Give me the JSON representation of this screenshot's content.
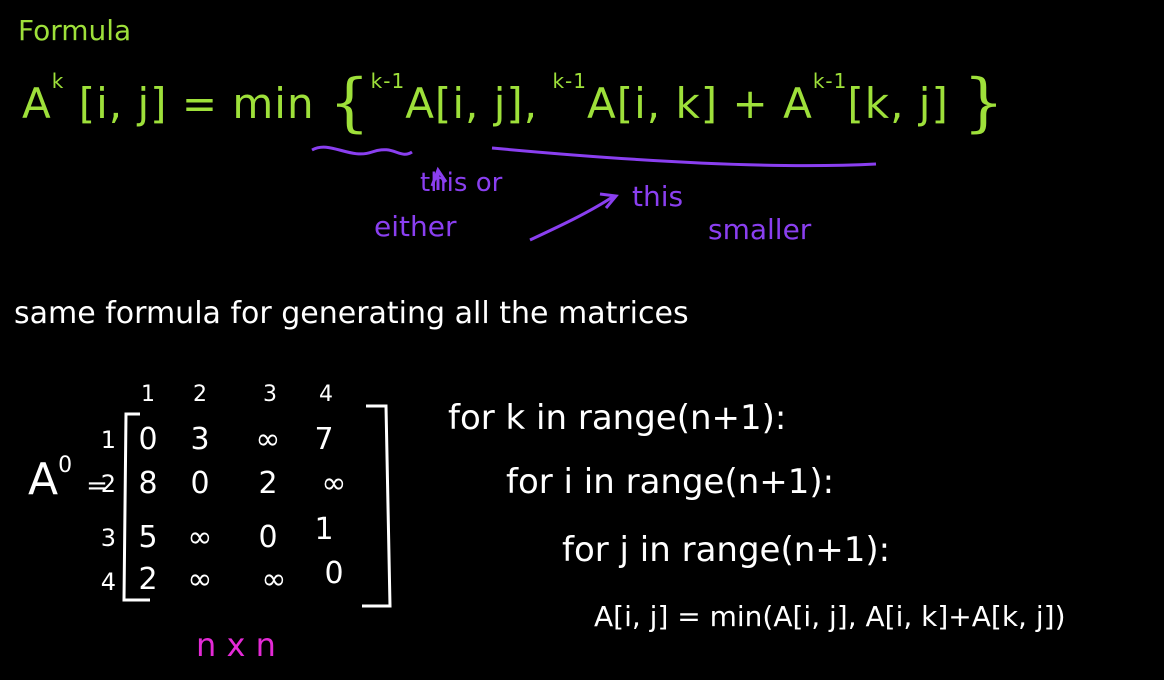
{
  "title": "Formula",
  "formula": {
    "lhs_base": "A",
    "lhs_sup": "k",
    "lhs_index": "[i, j] = min",
    "term1_sup": "k-1",
    "term1": "A[i, j],",
    "term2_sup": "k-1",
    "term2": "A[i, k] +",
    "term3_base": "A",
    "term3_sup": "k-1",
    "term3_index": "[k, j]"
  },
  "annotations": {
    "either": "either",
    "this_or": "this or",
    "this": "this",
    "smaller": "smaller"
  },
  "note": "same formula for generating all the matrices",
  "matrix": {
    "label_base": "A",
    "label_sup": "0",
    "label_eq": "=",
    "col_headers": [
      "1",
      "2",
      "3",
      "4"
    ],
    "row_headers": [
      "1",
      "2",
      "3",
      "4"
    ],
    "rows": [
      [
        "0",
        "3",
        "∞",
        "7"
      ],
      [
        "8",
        "0",
        "2",
        "∞"
      ],
      [
        "5",
        "∞",
        "0",
        "1"
      ],
      [
        "2",
        "∞",
        "∞",
        "0"
      ]
    ],
    "size_label": "n x n"
  },
  "code": [
    "for k in range(n+1):",
    "for i in range(n+1):",
    "for j in range(n+1):",
    "A[i, j] = min(A[i, j], A[i, k]+A[k, j])"
  ],
  "colors": {
    "background": "#000000",
    "formula": "#9ee03a",
    "annotation": "#8a3ff0",
    "size_label": "#e42ad6",
    "text": "#ffffff"
  }
}
